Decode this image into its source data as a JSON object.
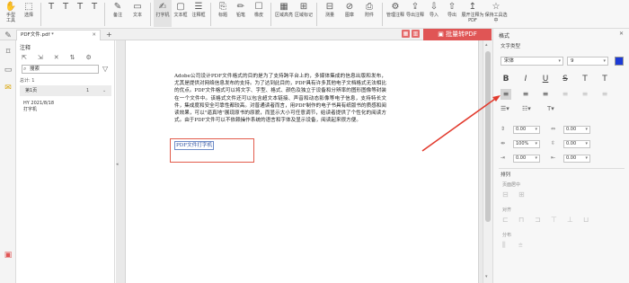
{
  "toolbar": {
    "buttons": [
      {
        "icon": "✋",
        "label": "手型\n工具"
      },
      {
        "icon": "⬚",
        "label": "选择"
      },
      {
        "icon": "T",
        "label": ""
      },
      {
        "icon": "T",
        "label": ""
      },
      {
        "icon": "T",
        "label": ""
      },
      {
        "icon": "T",
        "label": ""
      },
      {
        "icon": "✎",
        "label": "备注"
      },
      {
        "icon": "▭",
        "label": "文本"
      },
      {
        "icon": "✍",
        "label": "打字机"
      },
      {
        "icon": "▢",
        "label": "文本框"
      },
      {
        "icon": "☰",
        "label": "注释框"
      },
      {
        "icon": "⎘",
        "label": "标题"
      },
      {
        "icon": "✏",
        "label": "铅笔"
      },
      {
        "icon": "☐",
        "label": "橡皮"
      },
      {
        "icon": "▦",
        "label": "区域高亮"
      },
      {
        "icon": "⊞",
        "label": "区域标记"
      },
      {
        "icon": "⊟",
        "label": "测量"
      },
      {
        "icon": "⊘",
        "label": "图章"
      },
      {
        "icon": "⎙",
        "label": "附件"
      },
      {
        "icon": "⚙",
        "label": "管理注释"
      },
      {
        "icon": "⇪",
        "label": "导出注释"
      },
      {
        "icon": "⇩",
        "label": "导入"
      },
      {
        "icon": "⇧",
        "label": "导出"
      },
      {
        "icon": "↥",
        "label": "展开注释为PDF"
      },
      {
        "icon": "☆",
        "label": "保持工具选中"
      }
    ]
  },
  "tabs": {
    "active": "PDF文件.pdf *",
    "close": "✕",
    "add": "+"
  },
  "convert_button": "▣ 批量转PDF",
  "left_strip_icons": [
    "pen-icon",
    "bookmark-icon",
    "thumbnail-icon",
    "comment-icon",
    "attachment-icon"
  ],
  "annotations": {
    "title": "注释",
    "search_value": "搜索",
    "total": "总计: 1",
    "group": {
      "label": "第1页",
      "count": "1"
    },
    "item": {
      "author": "HY  2021/8/18",
      "text": "打字机"
    }
  },
  "document": {
    "paragraph": "Adobe公司设计PDF文件格式的目的是为了支持跨平台上的，多媒体集成的信息出版和发布，尤其是提供对网络信息发布的支持。为了达到此目的，PDF具有许多其他电子文档格式无法相比的优点。PDF文件格式可以将文字、字型、格式、颜色及独立于设备和分辨率的图形图像等封装在一个文件中。该格式文件还可以包含超文本链接、声音和动态影像等电子信息，支持特长文件，集成度和安全可靠性都较高。对普通读者而言，用PDF制作的电子书具有纸版书的质感和阅读效果，可以\"逼真地\"展现原书的原貌，而显示大小可任意调节，给读者提供了个性化的阅读方式。由于PDF文件可以不依赖操作系统的语言和字体及显示设备，阅读起来很方便。",
    "typed_text": "PDF文件打字机"
  },
  "props": {
    "header": "格式",
    "close": "✕",
    "text_type_label": "文字类型",
    "font_value": "宋体",
    "size_value": "9",
    "color": "#1c3ad6",
    "format_buttons": [
      "B",
      "I",
      "U",
      "S",
      "T",
      "T"
    ],
    "line_spacing": "0.00",
    "char_spacing": "0.00",
    "scale": "100%",
    "para_spacing": "0.00",
    "indent": "0.00",
    "indent2": "0.00",
    "arrange_label": "排列",
    "align_sub": "页面居中",
    "align_sub2": "对齐",
    "align_sub3": "分布"
  }
}
